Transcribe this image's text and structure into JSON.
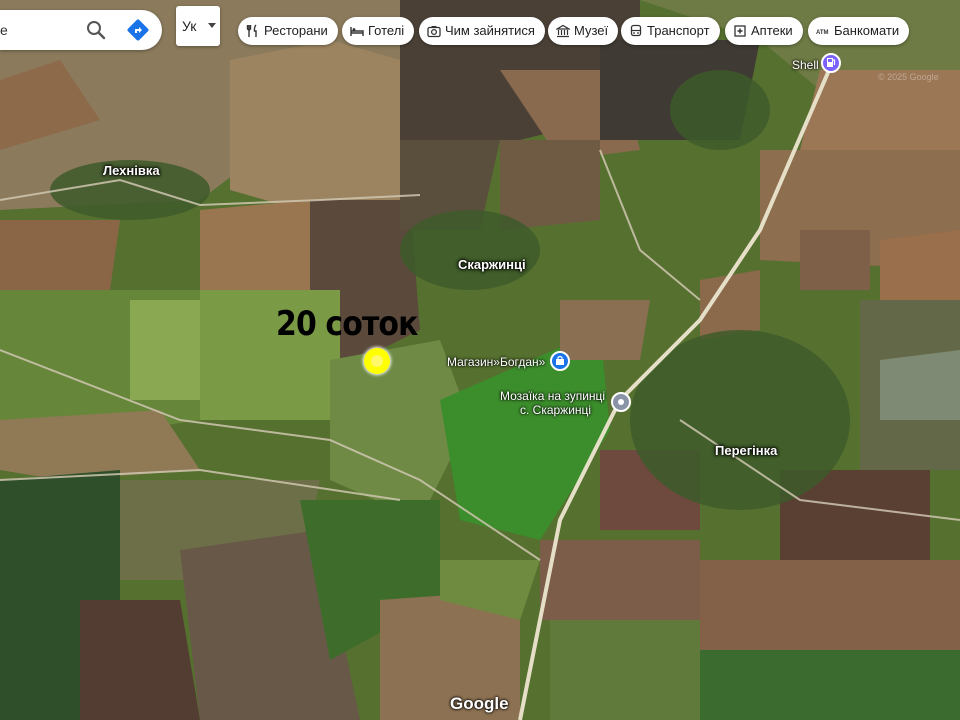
{
  "search": {
    "value": "e",
    "placeholder": ""
  },
  "language": {
    "selected": "Ук"
  },
  "categories": [
    {
      "label": "Ресторани",
      "icon": "fork-knife-icon"
    },
    {
      "label": "Готелі",
      "icon": "bed-icon"
    },
    {
      "label": "Чим зайнятися",
      "icon": "camera-icon"
    },
    {
      "label": "Музеї",
      "icon": "museum-icon"
    },
    {
      "label": "Транспорт",
      "icon": "bus-icon"
    },
    {
      "label": "Аптеки",
      "icon": "pharmacy-icon"
    },
    {
      "label": "Банкомати",
      "icon": "atm-icon"
    }
  ],
  "map": {
    "place_labels": {
      "lekhnivka": "Лехнівка",
      "skarzhyntsi": "Скаржинці",
      "perehinka": "Перегінка"
    },
    "pois": {
      "shell": {
        "label": "Shell",
        "icon": "gas-station-icon"
      },
      "shop": {
        "label": "Магазин»Богдан»",
        "icon": "shopping-bag-icon"
      },
      "stop": {
        "label_line1": "Мозаїка на зупинці",
        "label_line2": "с. Скаржинці",
        "icon": "attraction-icon"
      }
    },
    "annotation": "20 соток",
    "logo": "Google",
    "copyright": "© 2025 Google"
  },
  "colors": {
    "marker": "#ffff00",
    "shop_pin": "#1a73e8",
    "gas_pin": "#7b61ff",
    "stop_pin": "#8a94a6",
    "directions": "#1a73e8"
  }
}
